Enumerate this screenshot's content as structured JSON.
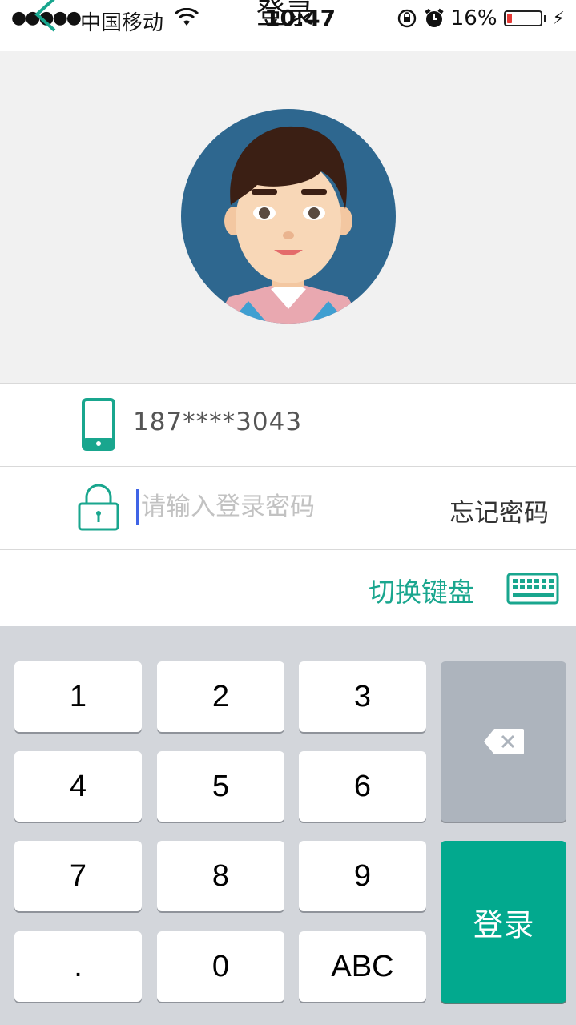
{
  "status_bar": {
    "signal": "●●●●●",
    "carrier": "中国移动",
    "time": "10:47",
    "battery_percent": "16%",
    "battery_level": 0.16
  },
  "nav": {
    "title": "登录"
  },
  "form": {
    "phone": "187****3043",
    "password_placeholder": "请输入登录密码",
    "forgot_password": "忘记密码",
    "switch_keyboard": "切换键盘"
  },
  "keyboard": {
    "keys": [
      "1",
      "2",
      "3",
      "4",
      "5",
      "6",
      "7",
      "8",
      "9",
      ".",
      "0",
      "ABC"
    ],
    "login": "登录"
  },
  "colors": {
    "accent": "#19a68e",
    "login_button": "#02a98e",
    "avatar_bg": "#2e678f"
  }
}
